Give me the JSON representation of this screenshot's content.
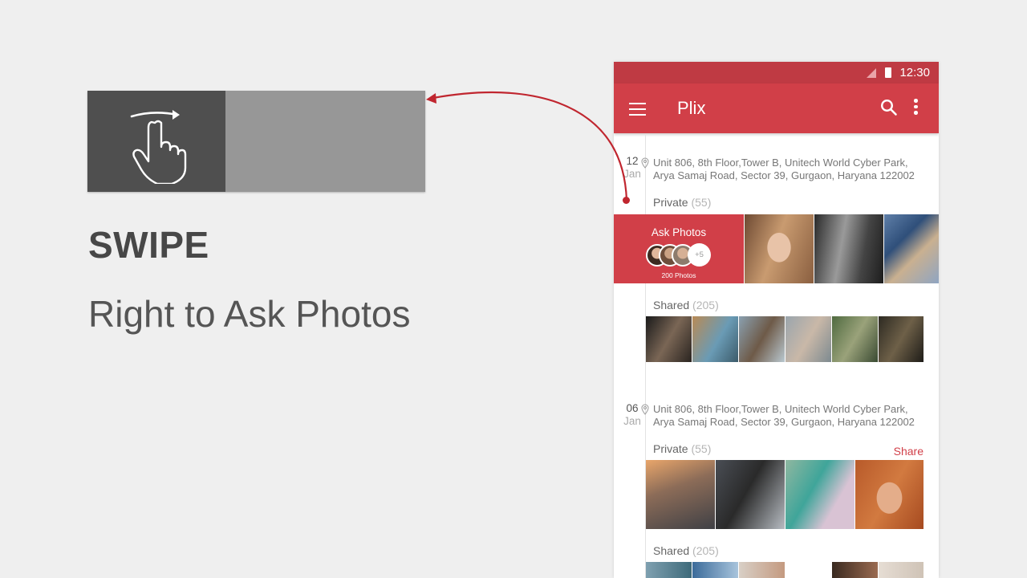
{
  "gesture": {
    "title": "SWIPE",
    "subtitle": "Right to Ask Photos",
    "icon": "swipe-right-hand-icon",
    "colors": {
      "dark": "#4f4f4f",
      "light": "#979797",
      "arrow": "#c0262f"
    }
  },
  "phone": {
    "status": {
      "time": "12:30"
    },
    "appbar": {
      "title": "Plix",
      "color": "#d13f48"
    },
    "entries": [
      {
        "day": "12",
        "month": "Jan",
        "address_line1": "Unit 806, 8th Floor,Tower B, Unitech World Cyber Park,",
        "address_line2": "Arya Samaj Road, Sector 39, Gurgaon, Haryana 122002",
        "private_label": "Private",
        "private_count": "(55)",
        "ask": {
          "title": "Ask Photos",
          "more": "+5",
          "count": "200 Photos"
        },
        "shared_label": "Shared",
        "shared_count": "(205)"
      },
      {
        "day": "06",
        "month": "Jan",
        "address_line1": "Unit 806, 8th Floor,Tower B, Unitech World Cyber Park,",
        "address_line2": "Arya Samaj Road, Sector 39, Gurgaon, Haryana 122002",
        "private_label": "Private",
        "private_count": "(55)",
        "share": "Share",
        "shared_label": "Shared",
        "shared_count": "(205)"
      }
    ]
  }
}
